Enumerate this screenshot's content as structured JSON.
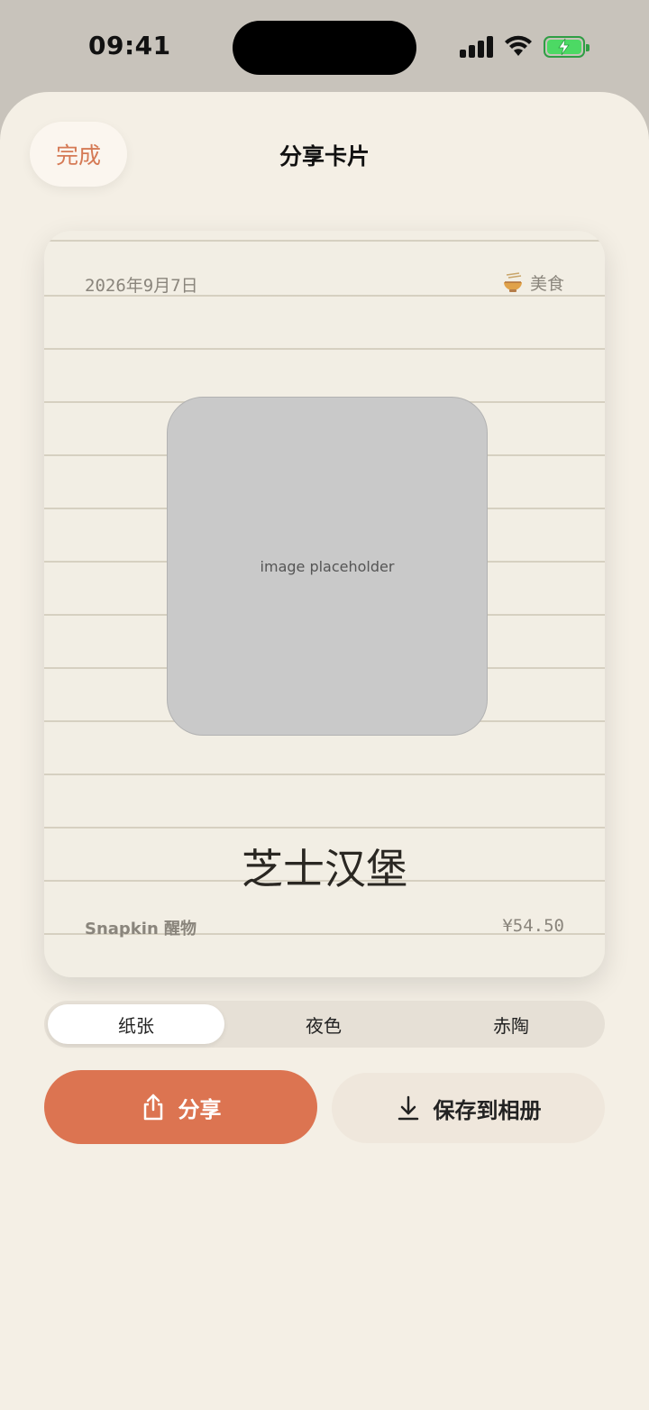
{
  "status_bar": {
    "time": "09:41"
  },
  "header": {
    "done_label": "完成",
    "title": "分享卡片"
  },
  "card": {
    "date": "2026年9月7日",
    "category": "美食",
    "category_icon": "noodle-bowl-icon",
    "image_placeholder": "image placeholder",
    "dish_name": "芝士汉堡",
    "brand": "Snapkin 醒物",
    "price": "¥54.50"
  },
  "theme_selector": {
    "options": [
      "纸张",
      "夜色",
      "赤陶"
    ],
    "selected": "纸张"
  },
  "actions": {
    "share_label": "分享",
    "save_label": "保存到相册"
  },
  "colors": {
    "accent": "#dc7451",
    "sheet_bg": "#f4efe5",
    "card_bg": "#f2eee4"
  }
}
